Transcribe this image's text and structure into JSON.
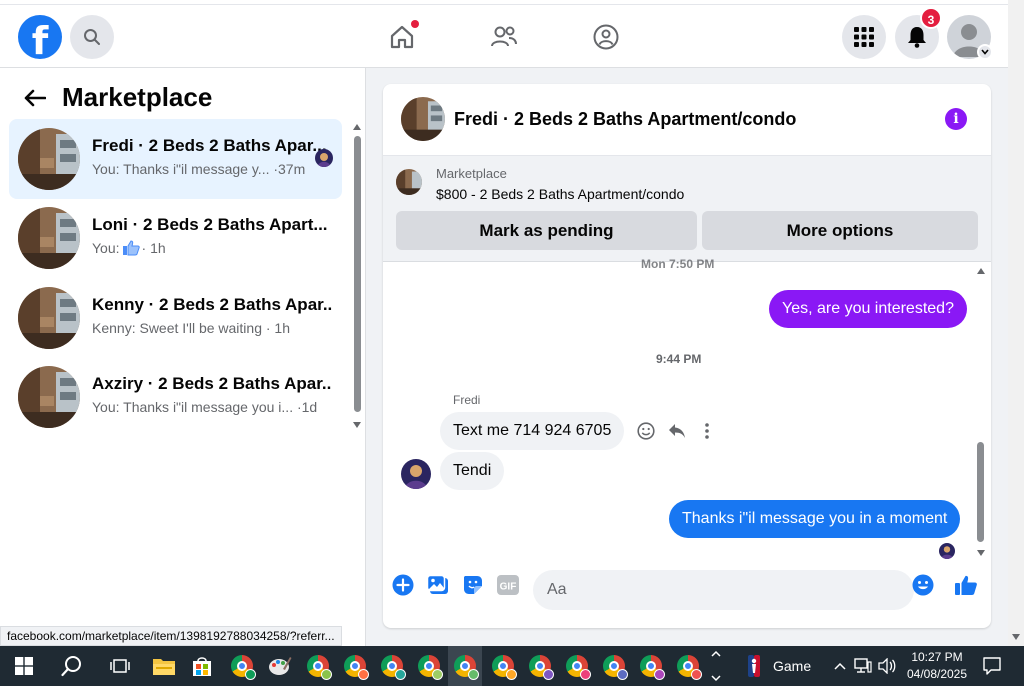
{
  "colors": {
    "brand": "#1877f2",
    "purple": "#8a18f5",
    "notification": "#e41e3f",
    "panel_bg": "#f0f2f5",
    "muted_text": "#65676b"
  },
  "nav": {
    "notifications_count": "3",
    "icons": [
      "facebook-logo",
      "search-icon",
      "home-icon",
      "friends-icon",
      "groups-icon",
      "menu-grid-icon",
      "bell-icon",
      "profile-avatar"
    ]
  },
  "left_panel": {
    "title": "Marketplace",
    "conversations": [
      {
        "name": "Fredi · 2 Beds 2 Baths Apar...",
        "preview": "You: Thanks i\"il message y... ·37m",
        "active": true
      },
      {
        "name": "Loni · 2 Beds 2 Baths Apart...",
        "preview_prefix": "You:",
        "preview_suffix": "· 1h",
        "active": false
      },
      {
        "name": "Kenny · 2 Beds 2 Baths Apar...",
        "preview": "Kenny: Sweet I'll be waiting · 1h",
        "active": false
      },
      {
        "name": "Axziry · 2 Beds 2 Baths Apar...",
        "preview": "You: Thanks i\"il message you i...  ·1d",
        "active": false
      }
    ],
    "status_url": "facebook.com/marketplace/item/1398192788034258/?referr..."
  },
  "chat": {
    "title": "Fredi · 2 Beds 2 Baths Apartment/condo",
    "listing": {
      "label": "Marketplace",
      "price_line": "$800 - 2 Beds 2 Baths Apartment/condo",
      "button_pending": "Mark as pending",
      "button_more": "More options"
    },
    "messages": {
      "stamp_1": "Mon 7:50 PM",
      "out_1": "Yes, are you interested?",
      "stamp_2": "9:44 PM",
      "sender": "Fredi",
      "in_1": "Text me 714 924 6705",
      "in_2": "Tendi",
      "out_2": "Thanks i\"il message you in a moment"
    },
    "composer": {
      "placeholder": "Aa"
    }
  },
  "taskbar": {
    "game_label": "Game",
    "time": "10:27 PM",
    "date": "04/08/2025"
  }
}
